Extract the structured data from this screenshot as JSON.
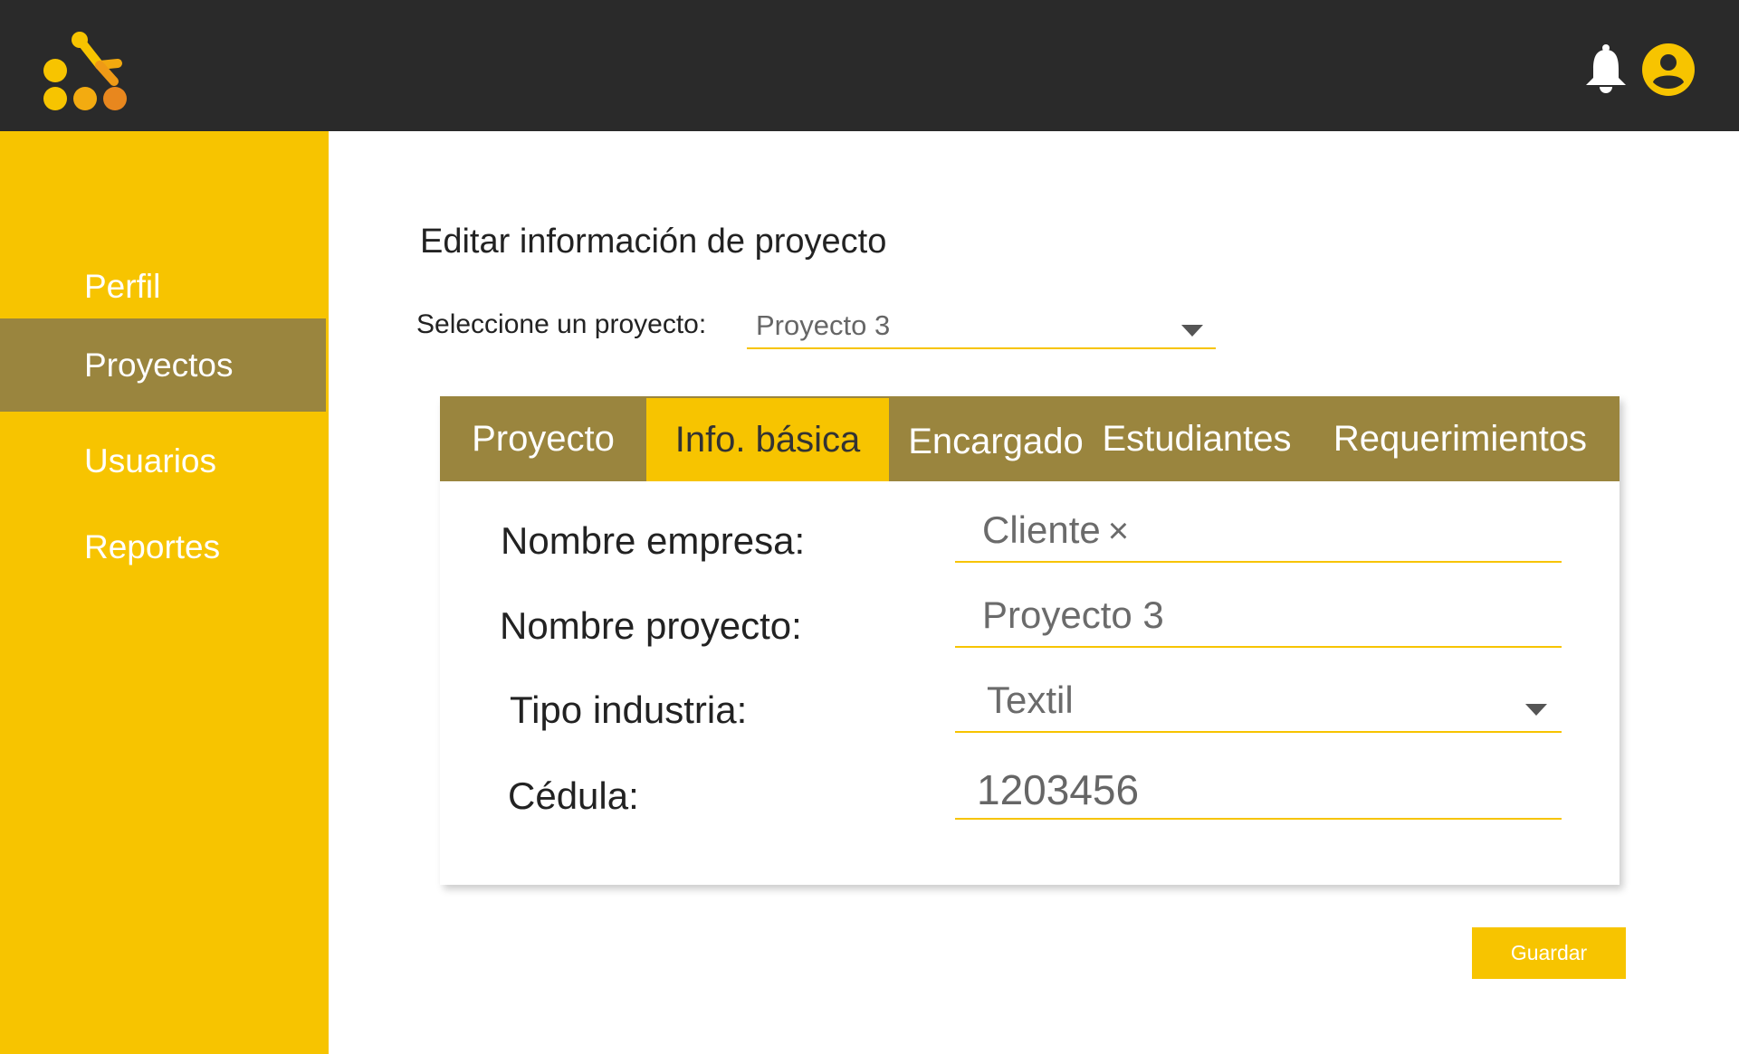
{
  "colors": {
    "topbar": "#2a2a2a",
    "accent_yellow": "#f7c400",
    "olive": "#9a853e",
    "logo_orange": "#e8871e"
  },
  "header": {
    "logo_icon": "molecule-logo-icon",
    "notification_icon": "bell-icon",
    "account_icon": "user-circle-icon"
  },
  "sidebar": {
    "items": [
      {
        "label": "Perfil",
        "active": false
      },
      {
        "label": "Proyectos",
        "active": true
      },
      {
        "label": "Usuarios",
        "active": false
      },
      {
        "label": "Reportes",
        "active": false
      }
    ]
  },
  "main": {
    "title": "Editar información de proyecto",
    "project_select": {
      "label": "Seleccione un proyecto:",
      "value": "Proyecto 3"
    },
    "tabs": [
      {
        "label": "Proyecto",
        "active": false
      },
      {
        "label": "Info. básica",
        "active": true
      },
      {
        "label": "Encargado",
        "active": false
      },
      {
        "label": "Estudiantes",
        "active": false
      },
      {
        "label": "Requerimientos",
        "active": false
      }
    ],
    "form": {
      "company_label": "Nombre empresa:",
      "company_value": "Cliente",
      "clear_glyph": "×",
      "project_name_label": "Nombre proyecto:",
      "project_name_value": "Proyecto 3",
      "industry_label": "Tipo industria:",
      "industry_value": "Textil",
      "id_label": "Cédula:",
      "id_value": "1203456"
    },
    "save_label": "Guardar"
  }
}
